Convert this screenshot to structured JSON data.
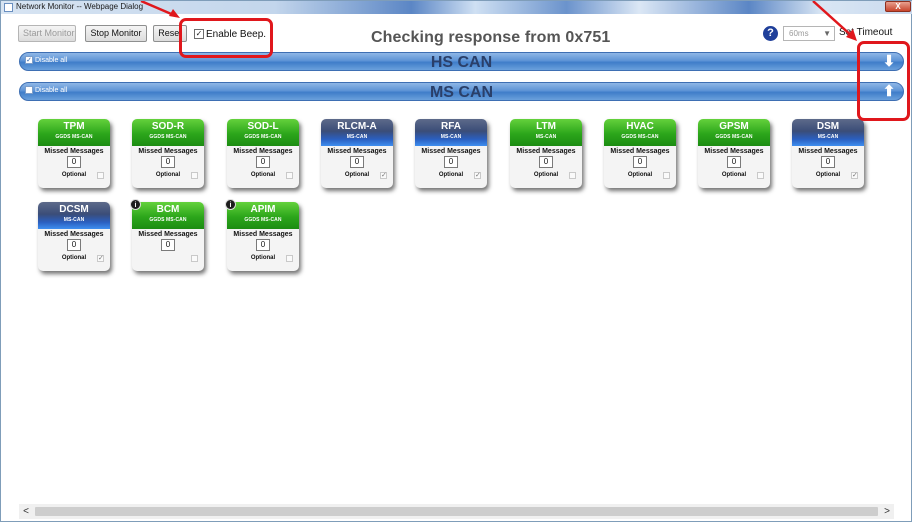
{
  "window": {
    "title": "Network Monitor -- Webpage Dialog",
    "close_label": "X"
  },
  "toolbar": {
    "start_label": "Start Monitor",
    "stop_label": "Stop Monitor",
    "reset_label": "Reset",
    "beep_label": "Enable Beep.",
    "beep_checked": true,
    "status_text": "Checking response from 0x751",
    "help_label": "?",
    "timeout_value": "60ms",
    "set_timeout_label": "Set Timeout"
  },
  "buses": [
    {
      "name": "HS CAN",
      "disable_label": "Disable all",
      "disable_checked": true,
      "arrow": "down"
    },
    {
      "name": "MS CAN",
      "disable_label": "Disable all",
      "disable_checked": false,
      "arrow": "up"
    }
  ],
  "ecus": [
    {
      "name": "TPM",
      "bus": "GGDS MS-CAN",
      "color": "green",
      "missed_label": "Missed Messages",
      "count": "0",
      "optional_label": "Optional",
      "optional_checked": false,
      "info": false
    },
    {
      "name": "SOD-R",
      "bus": "GGDS MS-CAN",
      "color": "green",
      "missed_label": "Missed Messages",
      "count": "0",
      "optional_label": "Optional",
      "optional_checked": false,
      "info": false
    },
    {
      "name": "SOD-L",
      "bus": "GGDS MS-CAN",
      "color": "green",
      "missed_label": "Missed Messages",
      "count": "0",
      "optional_label": "Optional",
      "optional_checked": false,
      "info": false
    },
    {
      "name": "RLCM-A",
      "bus": "MS-CAN",
      "color": "blue",
      "missed_label": "Missed Messages",
      "count": "0",
      "optional_label": "Optional",
      "optional_checked": true,
      "info": false
    },
    {
      "name": "RFA",
      "bus": "MS-CAN",
      "color": "blue",
      "missed_label": "Missed Messages",
      "count": "0",
      "optional_label": "Optional",
      "optional_checked": true,
      "info": false
    },
    {
      "name": "LTM",
      "bus": "MS-CAN",
      "color": "green",
      "missed_label": "Missed Messages",
      "count": "0",
      "optional_label": "Optional",
      "optional_checked": false,
      "info": false
    },
    {
      "name": "HVAC",
      "bus": "GGDS MS-CAN",
      "color": "green",
      "missed_label": "Missed Messages",
      "count": "0",
      "optional_label": "Optional",
      "optional_checked": false,
      "info": false
    },
    {
      "name": "GPSM",
      "bus": "GGDS MS-CAN",
      "color": "green",
      "missed_label": "Missed Messages",
      "count": "0",
      "optional_label": "Optional",
      "optional_checked": false,
      "info": false
    },
    {
      "name": "DSM",
      "bus": "MS-CAN",
      "color": "blue",
      "missed_label": "Missed Messages",
      "count": "0",
      "optional_label": "Optional",
      "optional_checked": true,
      "info": false
    },
    {
      "name": "DCSM",
      "bus": "MS-CAN",
      "color": "blue",
      "missed_label": "Missed Messages",
      "count": "0",
      "optional_label": "Optional",
      "optional_checked": true,
      "info": false
    },
    {
      "name": "BCM",
      "bus": "GGDS MS-CAN",
      "color": "green",
      "missed_label": "Missed Messages",
      "count": "0",
      "optional_label": "",
      "optional_checked": false,
      "info": true
    },
    {
      "name": "APIM",
      "bus": "GGDS MS-CAN",
      "color": "green",
      "missed_label": "Missed Messages",
      "count": "0",
      "optional_label": "Optional",
      "optional_checked": false,
      "info": true
    }
  ],
  "scrollbar": {
    "left_arrow": "<",
    "right_arrow": ">"
  },
  "colors": {
    "annotation_red": "#e0171c",
    "bus_bar_blue": "#4f89d0",
    "ecu_green": "#2ca61b",
    "ecu_blue": "#2a5fc0"
  }
}
